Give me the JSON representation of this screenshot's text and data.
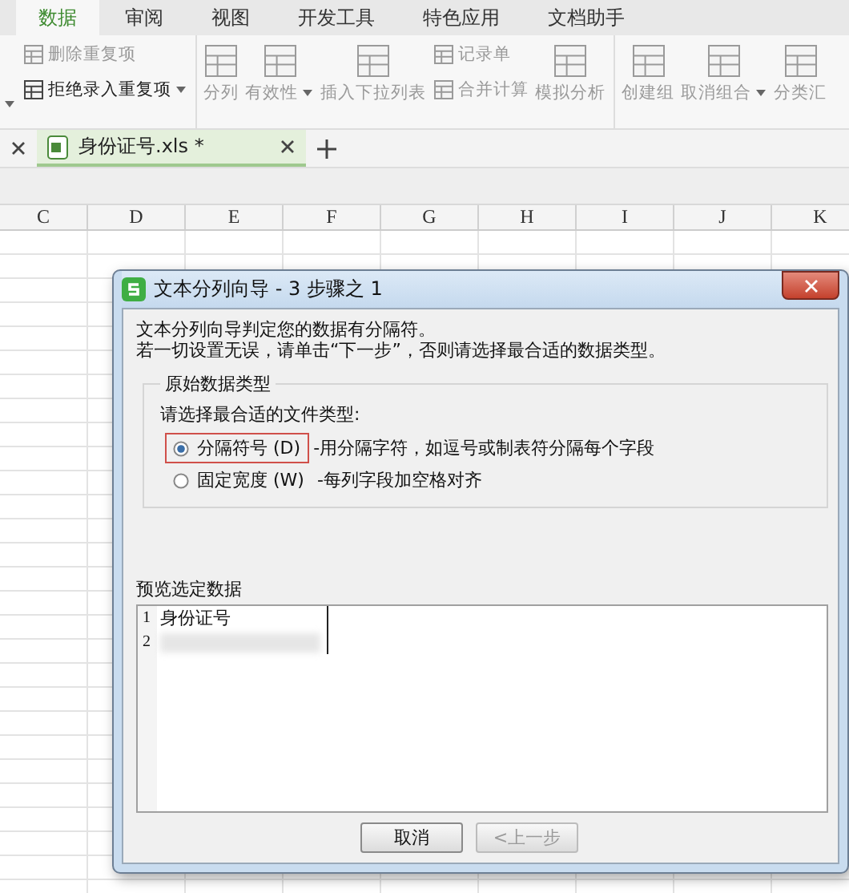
{
  "ribbon_tabs": [
    {
      "label": "数据",
      "selected": true
    },
    {
      "label": "审阅",
      "selected": false
    },
    {
      "label": "视图",
      "selected": false
    },
    {
      "label": "开发工具",
      "selected": false
    },
    {
      "label": "特色应用",
      "selected": false
    },
    {
      "label": "文档助手",
      "selected": false
    }
  ],
  "ribbon_groups": [
    {
      "items": [
        {
          "kind": "small",
          "label": "删除重复项",
          "disabled": true,
          "dropdown": false
        },
        {
          "kind": "small",
          "label": "拒绝录入重复项",
          "disabled": false,
          "dropdown": true
        }
      ]
    },
    {
      "items": [
        {
          "kind": "large",
          "label": "分列",
          "disabled": true,
          "dropdown": false
        },
        {
          "kind": "large",
          "label": "有效性",
          "disabled": true,
          "dropdown": true
        },
        {
          "kind": "large",
          "label": "插入下拉列表",
          "disabled": true,
          "dropdown": false
        },
        {
          "kind": "small",
          "label": "记录单",
          "disabled": true,
          "dropdown": false
        },
        {
          "kind": "small",
          "label": "合并计算",
          "disabled": true,
          "dropdown": false
        },
        {
          "kind": "large",
          "label": "模拟分析",
          "disabled": true,
          "dropdown": false
        }
      ]
    },
    {
      "items": [
        {
          "kind": "large",
          "label": "创建组",
          "disabled": true,
          "dropdown": false
        },
        {
          "kind": "large",
          "label": "取消组合",
          "disabled": true,
          "dropdown": true
        },
        {
          "kind": "large",
          "label": "分类汇",
          "disabled": true,
          "dropdown": false
        }
      ]
    }
  ],
  "document_tabs": [
    {
      "label": "身份证号.xls *",
      "selected": true
    }
  ],
  "sheet": {
    "columns": [
      "C",
      "D",
      "E",
      "F",
      "G",
      "H",
      "I",
      "J",
      "K"
    ]
  },
  "dialog": {
    "title": "文本分列向导 - 3 步骤之 1",
    "intro": [
      "文本分列向导判定您的数据有分隔符。",
      "若一切设置无误，请单击“下一步”，否则请选择最合适的数据类型。"
    ],
    "group_title": "原始数据类型",
    "prompt": "请选择最合适的文件类型:",
    "options": [
      {
        "label": "分隔符号 (D)",
        "description": "-用分隔字符，如逗号或制表符分隔每个字段",
        "selected": true,
        "highlighted": true
      },
      {
        "label": "固定宽度 (W)",
        "description": "-每列字段加空格对齐",
        "selected": false,
        "highlighted": false
      }
    ],
    "preview_title": "预览选定数据",
    "preview_rows": [
      {
        "number": "1",
        "text": "身份证号",
        "redacted": false
      },
      {
        "number": "2",
        "redacted": true
      }
    ],
    "buttons": [
      {
        "label": "取消",
        "disabled": false
      },
      {
        "label": "<上一步",
        "disabled": true
      }
    ]
  }
}
